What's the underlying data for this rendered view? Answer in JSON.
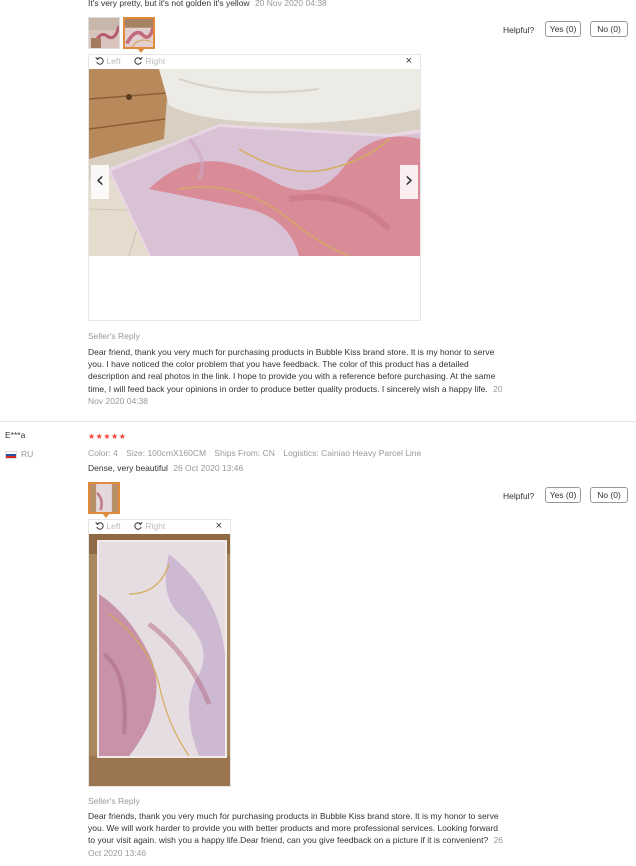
{
  "review1": {
    "text": "It's very pretty, but it's not golden it's yellow",
    "date": "20 Nov 2020 04:38",
    "helpful_label": "Helpful?",
    "yes_label": "Yes (0)",
    "no_label": "No (0)",
    "viewer": {
      "left": "Left",
      "right": "Right",
      "close": "×",
      "prev": "‹",
      "next": "›"
    },
    "seller_reply_title": "Seller's Reply",
    "seller_reply_lines": [
      "Dear friend, thank you very much for purchasing products in Bubble Kiss brand store. It is my honor to serve",
      "you. I have noticed the color problem that you have feedback. The color of this product has a detailed",
      "description and real photos in the link. I hope to provide you with a reference before purchasing. At the same",
      "time, I will feed back your opinions in order to produce better quality products. I sincerely wish a happy life."
    ],
    "seller_reply_date_part1": "20",
    "seller_reply_date_part2": "Nov 2020 04:38"
  },
  "review2": {
    "user": "E***a",
    "country": "RU",
    "stars": "★★★★★",
    "color_label": "Color:",
    "color_value": "4",
    "size_label": "Size:",
    "size_value": "100cmX160CM",
    "ships_label": "Ships From:",
    "ships_value": "CN",
    "logistics_label": "Logistics:",
    "logistics_value": "Cainiao Heavy Parcel Line",
    "text": "Dense, very beautiful",
    "date": "26 Oct 2020 13:46",
    "helpful_label": "Helpful?",
    "yes_label": "Yes (0)",
    "no_label": "No (0)",
    "viewer": {
      "left": "Left",
      "right": "Right",
      "close": "×"
    },
    "seller_reply_title": "Seller's Reply",
    "seller_reply_lines": [
      "Dear friends, thank you very much for purchasing products in Bubble Kiss brand store. It is my honor to serve",
      "you. We will work harder to provide you with better products and more professional services. Looking forward",
      "to your visit again. wish you a happy life.Dear friend, can you give feedback on a picture if it is convenient?"
    ],
    "seller_reply_date_part1": "26",
    "seller_reply_date_part2": "Oct 2020 13:46"
  },
  "icons": {
    "rotate_left": "rotate-left-icon",
    "rotate_right": "rotate-right-icon",
    "close": "close-icon"
  },
  "colors": {
    "accent": "#e08b3b",
    "stars": "#f44336",
    "muted": "#999999"
  }
}
